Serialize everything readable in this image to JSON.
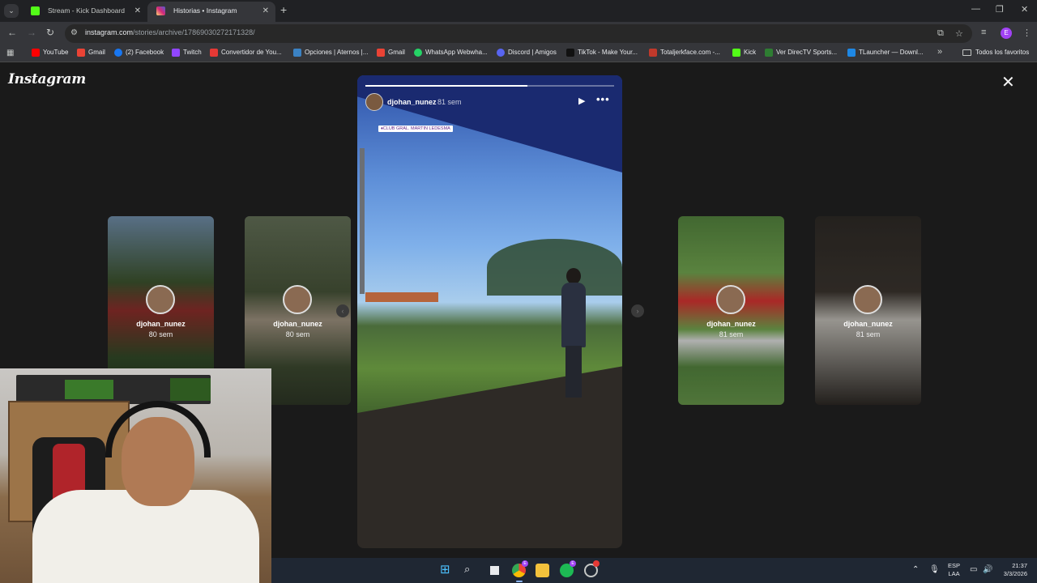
{
  "browser": {
    "tabs": [
      {
        "title": "Stream - Kick Dashboard",
        "favicon_color": "#53fc18",
        "active": false
      },
      {
        "title": "Historias • Instagram",
        "favicon_color": "#e1306c",
        "active": true
      }
    ],
    "url": {
      "host": "instagram.com",
      "path": "/stories/archive/17869030272171328/"
    },
    "profile_initial": "E",
    "bookmarks": [
      {
        "label": "YouTube",
        "icon_color": "#ff0000"
      },
      {
        "label": "Gmail",
        "icon_color": "#ea4335"
      },
      {
        "label": "(2) Facebook",
        "icon_color": "#1877f2"
      },
      {
        "label": "Twitch",
        "icon_color": "#9146ff"
      },
      {
        "label": "Convertidor de You...",
        "icon_color": "#e53935"
      },
      {
        "label": "Opciones | Aternos |...",
        "icon_color": "#3b82c4"
      },
      {
        "label": "Gmail",
        "icon_color": "#ea4335"
      },
      {
        "label": "WhatsApp Webwha...",
        "icon_color": "#25d366"
      },
      {
        "label": "Discord | Amigos",
        "icon_color": "#5865f2"
      },
      {
        "label": "TikTok - Make Your...",
        "icon_color": "#111111"
      },
      {
        "label": "Totaljerkface.com -...",
        "icon_color": "#c0392b"
      },
      {
        "label": "Kick",
        "icon_color": "#53fc18"
      },
      {
        "label": "Ver DirecTV Sports...",
        "icon_color": "#2e7d32"
      },
      {
        "label": "TLauncher — Downl...",
        "icon_color": "#1e88e5"
      }
    ],
    "bookmarks_folder": "Todos los favoritos"
  },
  "instagram": {
    "logo": "Instagram",
    "main_story": {
      "username": "djohan_nunez",
      "time": "81 sem",
      "sticker": "♦CLUB GRAL. MARTIN LEDESMA",
      "progress": 0.65
    },
    "side_stories": [
      {
        "username": "djohan_nunez",
        "time": "80 sem",
        "bg": "linear-gradient(to bottom,#8fb4d8 0%,#4d6a3a 35%,#b23a36 50%,#3f5e32 75%,#2f3e28 100%)"
      },
      {
        "username": "djohan_nunez",
        "time": "80 sem",
        "bg": "linear-gradient(to bottom,#7f8f70 0%,#5a6a48 40%,#c9b9a2 55%,#4d5d3d 80%,#3a4530 100%)"
      },
      {
        "username": "djohan_nunez",
        "time": "81 sem",
        "bg": "linear-gradient(to bottom,#4e7a3a 0%,#6a9a4a 30%,#c8302e 45%,#6b9a4a 60%,#cfcfcf 66%,#4e7a3a 80%,#5e8a44 100%)"
      },
      {
        "username": "djohan_nunez",
        "time": "81 sem",
        "bg": "linear-gradient(to bottom,#2e2a26 0%,#3a342e 40%,#bdbab3 55%,#2c2824 100%)"
      }
    ]
  },
  "taskbar": {
    "language": [
      "ESP",
      "LAA"
    ],
    "time": "21:37",
    "date": "3/3/2026"
  }
}
